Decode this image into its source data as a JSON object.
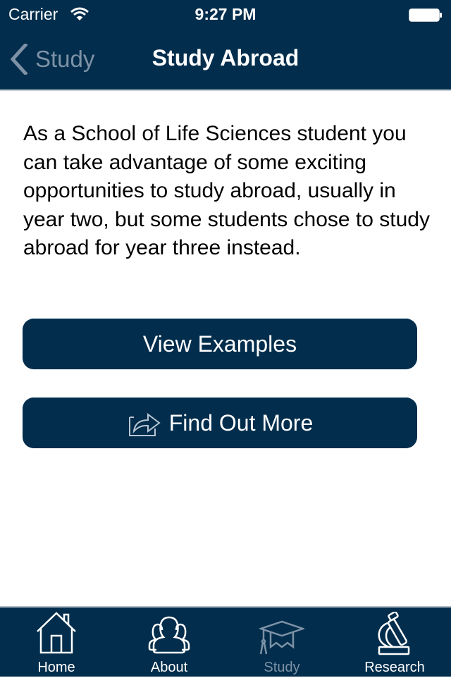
{
  "status_bar": {
    "carrier": "Carrier",
    "time": "9:27 PM",
    "wifi_icon": "wifi-icon",
    "battery_icon": "battery-full-icon"
  },
  "nav": {
    "back_label": "Study",
    "back_icon": "chevron-left-icon",
    "title": "Study Abroad"
  },
  "content": {
    "paragraph": "As a School of Life Sciences student you can take advantage of some exciting opportunities to study abroad, usually in year two, but some students chose to study abroad for year three instead."
  },
  "buttons": {
    "view_examples": "View Examples",
    "find_out_more": "Find Out More",
    "find_out_more_icon": "share-external-icon"
  },
  "tab_bar": {
    "items": [
      {
        "label": "Home",
        "icon": "home-icon",
        "active": false
      },
      {
        "label": "About",
        "icon": "people-icon",
        "active": false
      },
      {
        "label": "Study",
        "icon": "graduation-cap-icon",
        "active": true
      },
      {
        "label": "Research",
        "icon": "microscope-icon",
        "active": false
      }
    ]
  },
  "colors": {
    "primary": "#022d4c",
    "inactive_text": "#7d92a6",
    "background": "#ffffff"
  }
}
